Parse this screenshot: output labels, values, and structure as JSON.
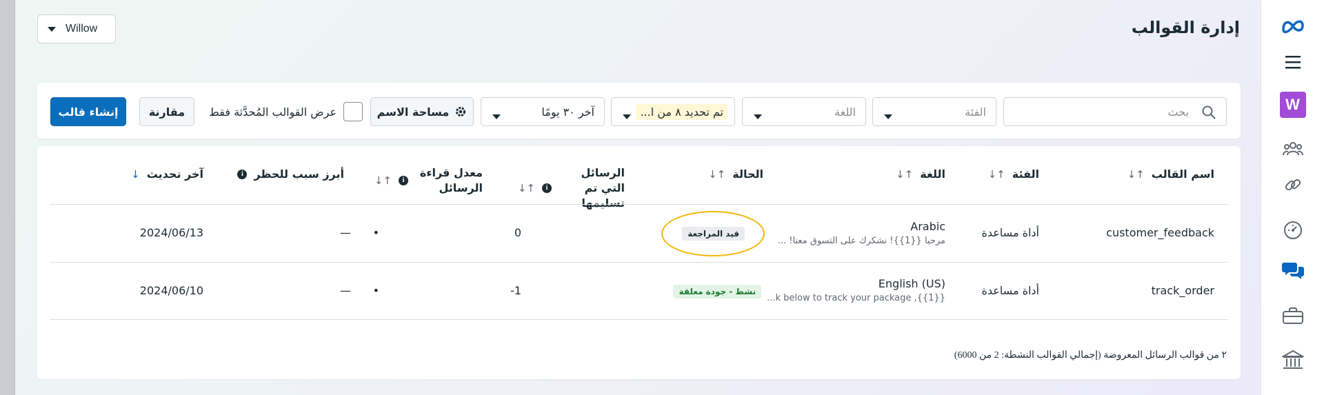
{
  "header": {
    "title": "إدارة القوالب",
    "account": "Willow"
  },
  "nav": {
    "items": [
      "meta-logo-icon",
      "menu-icon",
      "account-avatar",
      "people-icon",
      "link-icon",
      "dashboard-icon",
      "chat-icon",
      "briefcase-icon",
      "bank-icon"
    ],
    "avatar_letter": "W",
    "avatar_color": "#a14bd6",
    "active_color": "#0a66c2"
  },
  "filters": {
    "search_placeholder": "بحث",
    "category_placeholder": "الفئة",
    "language_placeholder": "اللغة",
    "date_range_chip": "تم تحديد ٨ من ا...",
    "period": "آخر ٣٠ يومًا",
    "namespace_button": "مساحة الاسم",
    "checkbox_label": "عرض القوالب المُحدَّثة فقط",
    "compare_button": "مقارنة",
    "create_button": "إنشاء قالب"
  },
  "table": {
    "columns": {
      "name": "اسم القالب",
      "category": "الفئة",
      "language": "اللغة",
      "status": "الحالة",
      "delivered": "الرسائل التي تم تسليمها",
      "read_rate": "معدل قراءة الرسائل",
      "block_reason": "أبرز سبب للحظر",
      "last_updated": "آخر تحديث"
    },
    "rows": [
      {
        "name": "customer_feedback",
        "category": "أداة مساعدة",
        "language": "Arabic",
        "preview": "مرحبا {{1}}! نشكرك على التسوق معنا! ...",
        "status": "قيد المراجعة",
        "delivered": "0",
        "read_rate": "•",
        "block_reason": "—",
        "last_updated": "2024/06/13"
      },
      {
        "name": "track_order",
        "category": "أداة مساعدة",
        "language": "English (US)",
        "preview": "...k below to track your package ,{{1}}",
        "status": "نشط - جودة معلقة",
        "delivered": "-1",
        "read_rate": "•",
        "block_reason": "—",
        "last_updated": "2024/06/10"
      }
    ],
    "footer": "٢ من قوالب الرسائل المعروضة (إجمالي القوالب النشطة: 2 من 6000)"
  },
  "colors": {
    "primary": "#0a6ebd",
    "highlight_ring": "#f2b80a",
    "active_badge_bg": "#e3f4e6",
    "active_badge_text": "#1b7a33"
  }
}
